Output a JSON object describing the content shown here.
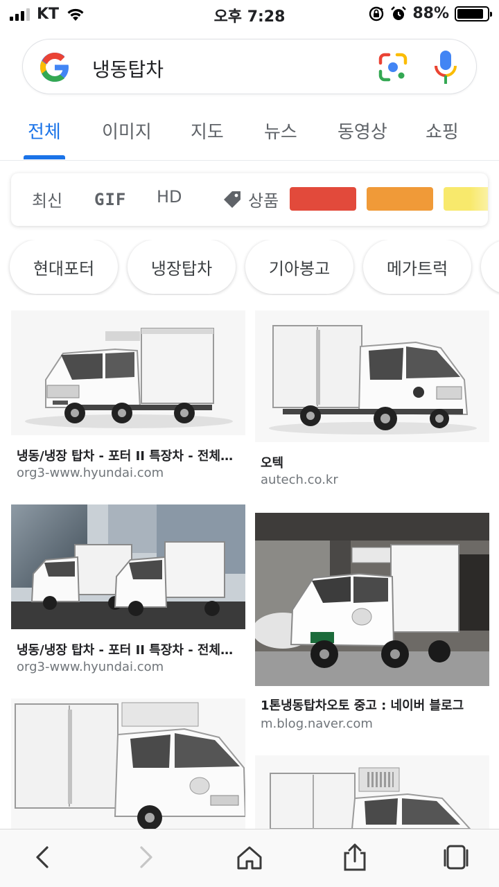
{
  "status_bar": {
    "carrier": "KT",
    "time": "오후 7:28",
    "battery_percent": "88%",
    "battery_level": 0.88,
    "icons": [
      "signal-icon",
      "wifi-icon",
      "rotation-lock-icon",
      "alarm-icon",
      "battery-icon"
    ]
  },
  "search": {
    "query": "냉동탑차",
    "logo": "google-g-logo",
    "lens_icon": "google-lens-icon",
    "mic_icon": "mic-icon"
  },
  "tabs": [
    {
      "label": "전체",
      "active": true
    },
    {
      "label": "이미지",
      "active": false
    },
    {
      "label": "지도",
      "active": false
    },
    {
      "label": "뉴스",
      "active": false
    },
    {
      "label": "동영상",
      "active": false
    },
    {
      "label": "쇼핑",
      "active": false
    }
  ],
  "filters": {
    "recent": "최신",
    "gif": "GIF",
    "hd": "HD",
    "products": "상품",
    "colors": [
      "#e24a3b",
      "#f09a38",
      "#f8e96c"
    ]
  },
  "chips": [
    "현대포터",
    "냉장탑차",
    "기아봉고",
    "메가트럭"
  ],
  "results": [
    {
      "title": "냉동/냉장 탑차 - 포터 II 특장차 - 전체모...",
      "source": "org3-www.hyundai.com"
    },
    {
      "title": "오텍",
      "source": "autech.co.kr"
    },
    {
      "title": "냉동/냉장 탑차 - 포터 II 특장차 - 전체모...",
      "source": "org3-www.hyundai.com"
    },
    {
      "title": "1톤냉동탑차오토 중고 : 네이버 블로그",
      "source": "m.blog.naver.com"
    },
    {
      "title": "",
      "source": ""
    },
    {
      "title": "",
      "source": ""
    }
  ],
  "bottom_bar": {
    "icons": [
      "back-icon",
      "forward-icon",
      "home-icon",
      "share-icon",
      "tabs-icon"
    ]
  }
}
